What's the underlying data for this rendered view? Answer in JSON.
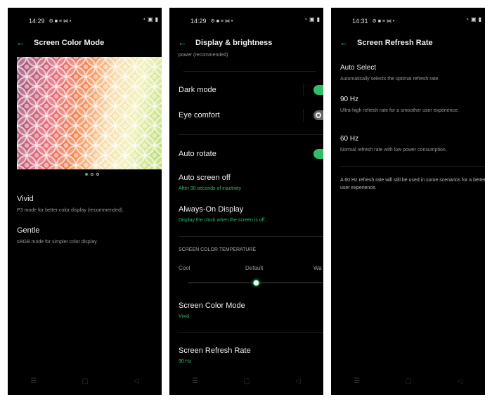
{
  "status": [
    {
      "time": "14:29"
    },
    {
      "time": "14:29"
    },
    {
      "time": "14:31"
    }
  ],
  "accent": "#2ebd6b",
  "left": {
    "title": "Screen Color Mode",
    "page_dots": 3,
    "active_dot": 1,
    "options": [
      {
        "label": "Vivid",
        "desc": "P3 mode for better color display (recommended)."
      },
      {
        "label": "Gentle",
        "desc": "sRGB mode for simpler color display."
      }
    ]
  },
  "middle": {
    "title": "Display & brightness",
    "cut_text": "power  (recommended)",
    "dark_mode": {
      "label": "Dark mode",
      "on": true
    },
    "eye_comfort": {
      "label": "Eye comfort",
      "on": false
    },
    "auto_rotate": {
      "label": "Auto rotate",
      "on": true
    },
    "auto_screen_off": {
      "label": "Auto screen off",
      "value": "After 30 seconds of inactivity"
    },
    "aod": {
      "label": "Always-On Display",
      "value": "Display the clock when the screen is off."
    },
    "temp": {
      "heading": "SCREEN COLOR TEMPERATURE",
      "cool": "Cool",
      "default": "Default",
      "warm": "Wa",
      "level": 0.5
    },
    "color_mode": {
      "label": "Screen Color Mode",
      "value": "Vivid"
    },
    "refresh": {
      "label": "Screen Refresh Rate",
      "value": "90 Hz"
    }
  },
  "right": {
    "title": "Screen Refresh Rate",
    "options": [
      {
        "label": "Auto Select",
        "desc": "Automatically selects the optimal refresh rate."
      },
      {
        "label": "90 Hz",
        "desc": "Ultra-high refresh rate for a smoother user experience."
      },
      {
        "label": "60 Hz",
        "desc": "Normal refresh rate with low power consumption."
      }
    ],
    "note": "A 60 Hz refresh rate will still be used in some scenarios for a better user experience."
  },
  "nav": {
    "menu": "☰",
    "home": "▢",
    "back": "◁"
  }
}
